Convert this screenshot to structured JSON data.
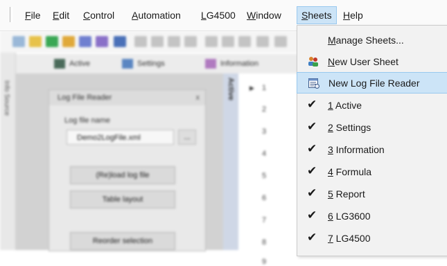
{
  "menubar": {
    "items": [
      {
        "accel": "F",
        "rest": "ile"
      },
      {
        "accel": "E",
        "rest": "dit"
      },
      {
        "accel": "C",
        "rest": "ontrol"
      },
      {
        "accel": "A",
        "rest": "utomation"
      },
      {
        "accel": "L",
        "rest": "G4500"
      },
      {
        "accel": "W",
        "rest": "indow"
      },
      {
        "accel": "S",
        "rest": "heets"
      },
      {
        "accel": "H",
        "rest": "elp"
      }
    ],
    "active_index": 6
  },
  "background": {
    "tabs": [
      "Active",
      "Settings",
      "Information"
    ],
    "left_strip_label": "Info Source",
    "dialog": {
      "title": "Log File Reader",
      "close": "x",
      "field_label": "Log file name",
      "field_value": "Demo2LogFile.xml",
      "browse": "...",
      "buttons": [
        "(Re)load log file",
        "Table layout",
        "Reorder selection"
      ]
    },
    "vertical_tab": "Active",
    "row_numbers": [
      "1",
      "2",
      "3",
      "4",
      "5",
      "6",
      "7",
      "8",
      "9"
    ]
  },
  "sheets_menu": {
    "items": [
      {
        "icon": "none",
        "checked": false,
        "num": "",
        "accel": "M",
        "rest": "anage Sheets..."
      },
      {
        "icon": "user-sheet-icon",
        "checked": false,
        "num": "",
        "accel": "N",
        "rest": "ew User Sheet"
      },
      {
        "icon": "log-file-reader-icon",
        "checked": false,
        "num": "",
        "accel": "",
        "rest": "New Log File Reader",
        "highlighted": true
      },
      {
        "icon": "check-icon",
        "checked": true,
        "num": "1",
        "rest": " Active"
      },
      {
        "icon": "check-icon",
        "checked": true,
        "num": "2",
        "rest": " Settings"
      },
      {
        "icon": "check-icon",
        "checked": true,
        "num": "3",
        "rest": " Information"
      },
      {
        "icon": "check-icon",
        "checked": true,
        "num": "4",
        "rest": " Formula"
      },
      {
        "icon": "check-icon",
        "checked": true,
        "num": "5",
        "rest": " Report"
      },
      {
        "icon": "check-icon",
        "checked": true,
        "num": "6",
        "rest": " LG3600"
      },
      {
        "icon": "check-icon",
        "checked": true,
        "num": "7",
        "rest": " LG4500"
      }
    ]
  },
  "colors": {
    "highlight": "#cce4f7",
    "highlight_border": "#99c9ef",
    "menu_bg": "#f2f2f2"
  }
}
